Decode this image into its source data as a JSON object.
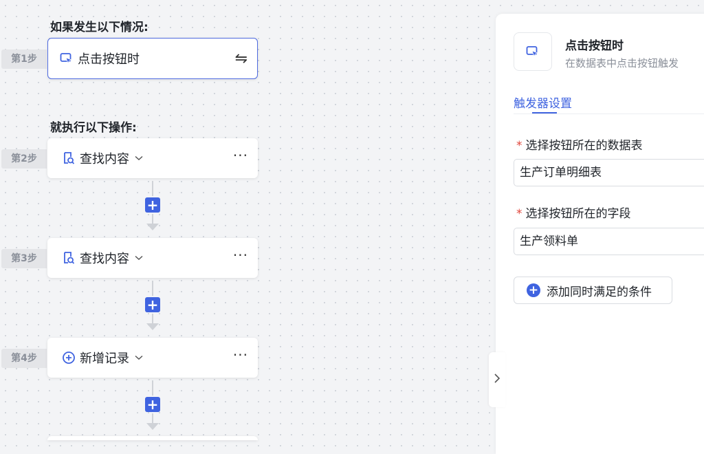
{
  "flow": {
    "if_title": "如果发生以下情况:",
    "then_title": "就执行以下操作:",
    "trigger": {
      "step_label": "第1步",
      "label": "点击按钮时",
      "icon": "cursor-click-icon",
      "action_icon": "swap-icon",
      "action_glyph": "⇋"
    },
    "steps": [
      {
        "step_label": "第2步",
        "label": "查找内容",
        "icon": "find-record-icon",
        "more": "···"
      },
      {
        "step_label": "第3步",
        "label": "查找内容",
        "icon": "find-record-icon",
        "more": "···"
      },
      {
        "step_label": "第4步",
        "label": "新增记录",
        "icon": "add-circle-icon",
        "more": "···"
      }
    ],
    "add_glyph": "+"
  },
  "panel": {
    "title": "点击按钮时",
    "subtitle": "在数据表中点击按钮触发",
    "tab": "触发器设置",
    "field1_label": "选择按钮所在的数据表",
    "field1_value": "生产订单明细表",
    "field2_label": "选择按钮所在的字段",
    "field2_value": "生产领料单",
    "required_mark": "*",
    "add_condition": "添加同时满足的条件",
    "add_condition_glyph": "+"
  },
  "colors": {
    "accent": "#3f63e0",
    "required": "#e0453a"
  }
}
